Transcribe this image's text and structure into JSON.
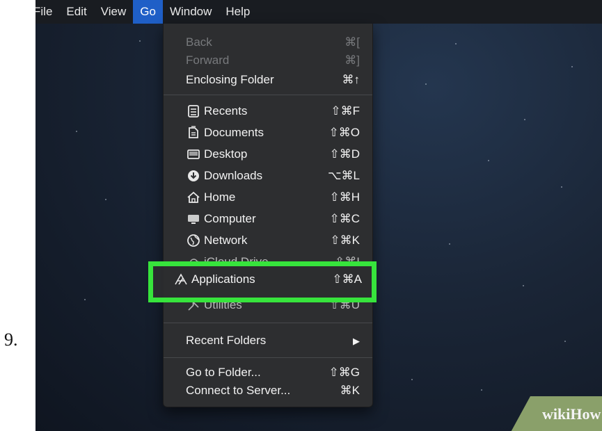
{
  "step": {
    "number": "9."
  },
  "menubar": {
    "items": [
      {
        "label": "File"
      },
      {
        "label": "Edit"
      },
      {
        "label": "View"
      },
      {
        "label": "Go",
        "active": true
      },
      {
        "label": "Window"
      },
      {
        "label": "Help"
      }
    ]
  },
  "go_menu": {
    "back": {
      "label": "Back",
      "shortcut": "⌘["
    },
    "forward": {
      "label": "Forward",
      "shortcut": "⌘]"
    },
    "enclosing_folder": {
      "label": "Enclosing Folder",
      "shortcut": "⌘↑"
    },
    "recents": {
      "label": "Recents",
      "shortcut": "⇧⌘F",
      "icon": "recents-icon"
    },
    "documents": {
      "label": "Documents",
      "shortcut": "⇧⌘O",
      "icon": "documents-icon"
    },
    "desktop": {
      "label": "Desktop",
      "shortcut": "⇧⌘D",
      "icon": "desktop-icon"
    },
    "downloads": {
      "label": "Downloads",
      "shortcut": "⌥⌘L",
      "icon": "downloads-icon"
    },
    "home": {
      "label": "Home",
      "shortcut": "⇧⌘H",
      "icon": "home-icon"
    },
    "computer": {
      "label": "Computer",
      "shortcut": "⇧⌘C",
      "icon": "computer-icon"
    },
    "network": {
      "label": "Network",
      "shortcut": "⇧⌘K",
      "icon": "network-icon"
    },
    "icloud_drive": {
      "label": "iCloud Drive",
      "shortcut": "⇧⌘I",
      "icon": "icloud-icon"
    },
    "applications": {
      "label": "Applications",
      "shortcut": "⇧⌘A",
      "icon": "applications-icon"
    },
    "utilities": {
      "label": "Utilities",
      "shortcut": "⇧⌘U",
      "icon": "utilities-icon"
    },
    "recent_folders": {
      "label": "Recent Folders",
      "submenu_arrow": "▶"
    },
    "go_to_folder": {
      "label": "Go to Folder...",
      "shortcut": "⇧⌘G"
    },
    "connect_to_server": {
      "label": "Connect to Server...",
      "shortcut": "⌘K"
    }
  },
  "colors": {
    "highlight_border": "#37e43c",
    "menubar_active": "#1f5fc7",
    "menu_background": "#2d2e30",
    "watermark_green": "#8aa06a"
  },
  "watermark": {
    "text": "wikiHow"
  }
}
